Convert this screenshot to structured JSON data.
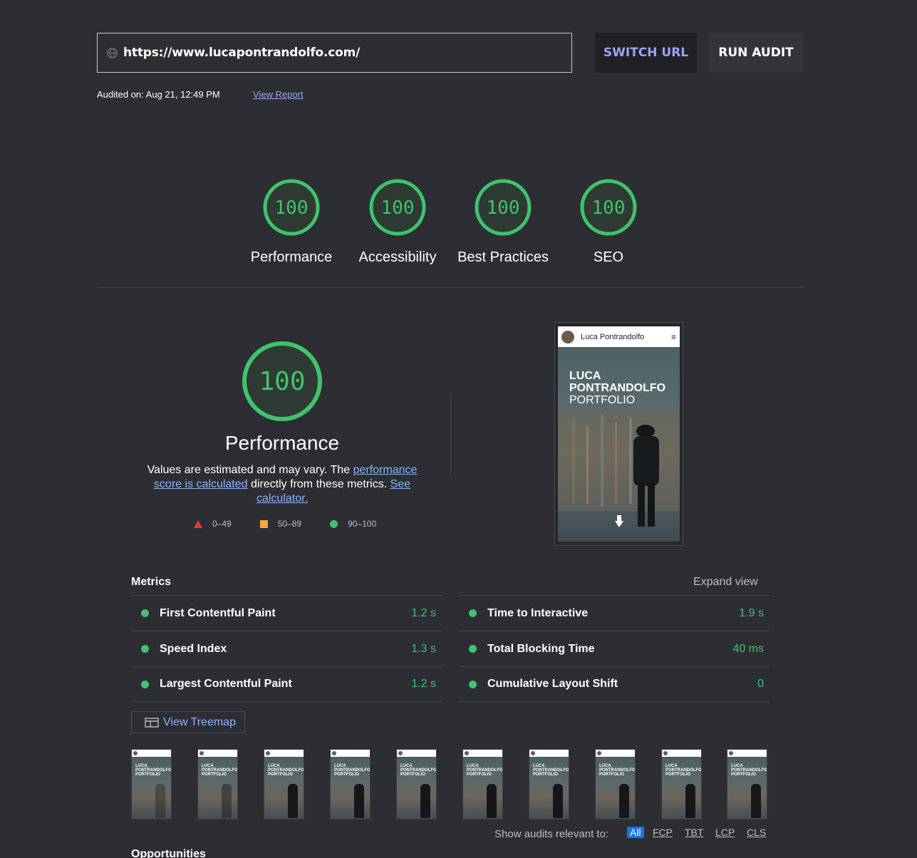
{
  "toolbar": {
    "url": "https://www.lucapontrandolfo.com/",
    "switch_label": "SWITCH URL",
    "run_label": "RUN AUDIT"
  },
  "audit": {
    "audited_on": "Audited on: Aug 21, 12:49 PM",
    "view_report": "View Report"
  },
  "categories": [
    {
      "score": "100",
      "label": "Performance"
    },
    {
      "score": "100",
      "label": "Accessibility"
    },
    {
      "score": "100",
      "label": "Best Practices"
    },
    {
      "score": "100",
      "label": "SEO"
    }
  ],
  "performance": {
    "score": "100",
    "title": "Performance",
    "desc_prefix": "Values are estimated and may vary. The ",
    "desc_link1": "performance score is calculated",
    "desc_middle": " directly from these metrics. ",
    "desc_link2": "See calculator.",
    "legend": {
      "fail": "0–49",
      "average": "50–89",
      "pass": "90–100"
    }
  },
  "screenshot": {
    "site_name": "Luca Pontrandolfo",
    "hero_line1": "LUCA",
    "hero_line2": "PONTRANDOLFO",
    "hero_line3": "PORTFOLIO"
  },
  "metrics": {
    "heading": "Metrics",
    "expand": "Expand view",
    "left": [
      {
        "name": "First Contentful Paint",
        "value": "1.2 s"
      },
      {
        "name": "Speed Index",
        "value": "1.3 s"
      },
      {
        "name": "Largest Contentful Paint",
        "value": "1.2 s"
      }
    ],
    "right": [
      {
        "name": "Time to Interactive",
        "value": "1.9 s"
      },
      {
        "name": "Total Blocking Time",
        "value": "40 ms"
      },
      {
        "name": "Cumulative Layout Shift",
        "value": "0"
      }
    ]
  },
  "treemap": {
    "label": "View Treemap"
  },
  "filmstrip": {
    "frame_site": "Luca Pontrandolfo",
    "frame_title": "LUCA PONTRANDOLFO",
    "frame_sub": "PORTFOLIO"
  },
  "filters": {
    "label": "Show audits relevant to:",
    "all": "All",
    "fcp": "FCP",
    "tbt": "TBT",
    "lcp": "LCP",
    "cls": "CLS"
  },
  "opportunities": {
    "heading": "Opportunities"
  },
  "colors": {
    "pass": "#3fc46a",
    "average": "#f4a93d",
    "fail": "#e53935",
    "link": "#8ab4f8"
  }
}
